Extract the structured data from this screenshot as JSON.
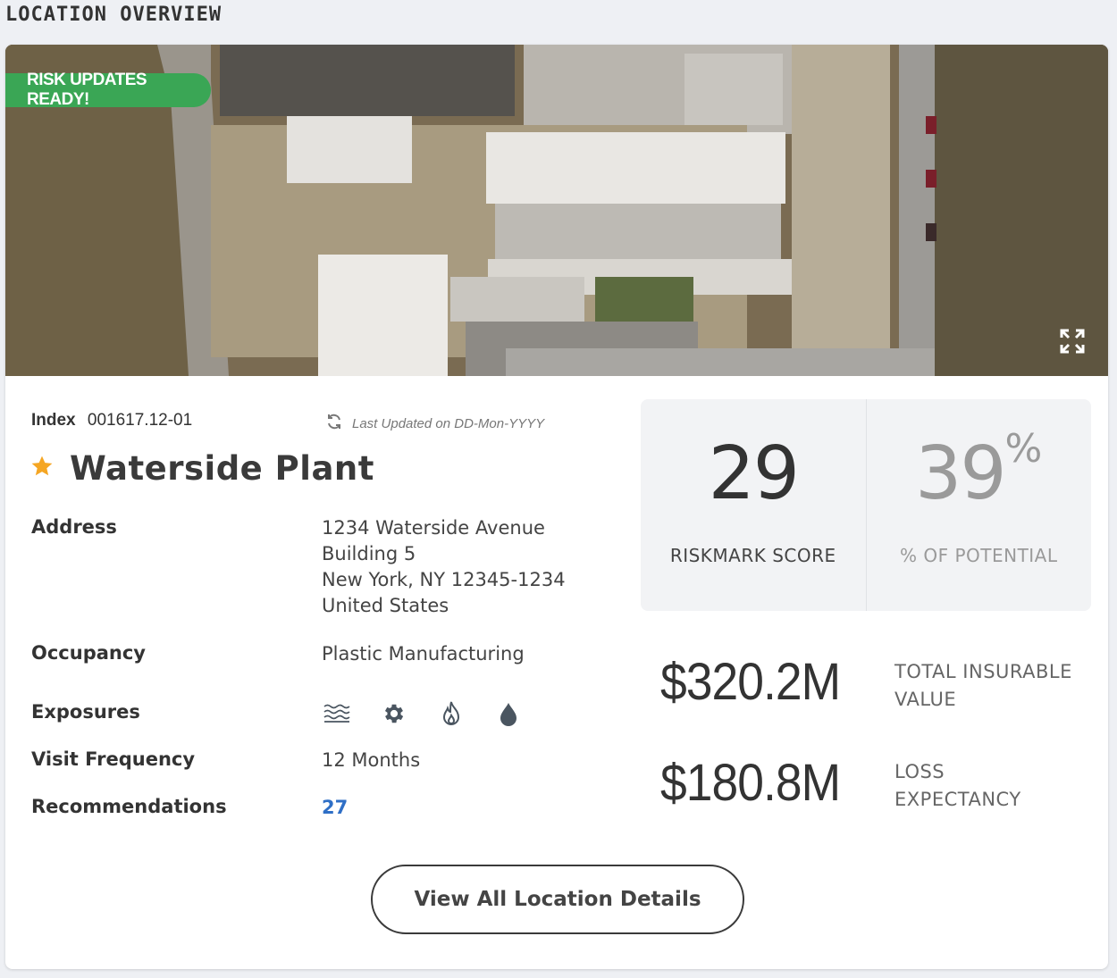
{
  "section": {
    "title": "LOCATION OVERVIEW"
  },
  "banner": {
    "badge": "RISK UPDATES READY!"
  },
  "location": {
    "index_label": "Index",
    "index_value": "001617.12-01",
    "last_updated": "Last Updated on DD-Mon-YYYY",
    "name": "Waterside Plant",
    "favorite": true
  },
  "details": {
    "address_label": "Address",
    "address_lines": [
      "1234 Waterside Avenue",
      "Building 5",
      "New York, NY 12345-1234",
      "United States"
    ],
    "occupancy_label": "Occupancy",
    "occupancy_value": "Plastic Manufacturing",
    "exposures_label": "Exposures",
    "exposures_icons": [
      "flood-icon",
      "gear-icon",
      "fire-icon",
      "water-drop-icon"
    ],
    "visit_label": "Visit Frequency",
    "visit_value": "12 Months",
    "recs_label": "Recommendations",
    "recs_value": "27"
  },
  "scores": {
    "riskmark_value": "29",
    "riskmark_label": "RISKMARK SCORE",
    "potential_value": "39",
    "potential_unit": "%",
    "potential_label": "% OF POTENTIAL"
  },
  "financials": {
    "tiv_value": "$320.2M",
    "tiv_label_1": "TOTAL INSURABLE",
    "tiv_label_2": "VALUE",
    "loss_value": "$180.8M",
    "loss_label_1": "LOSS",
    "loss_label_2": "EXPECTANCY"
  },
  "actions": {
    "view_all": "View All Location Details"
  },
  "colors": {
    "accent_green": "#3aa655",
    "star": "#f5a623",
    "link": "#2f6fc6"
  }
}
